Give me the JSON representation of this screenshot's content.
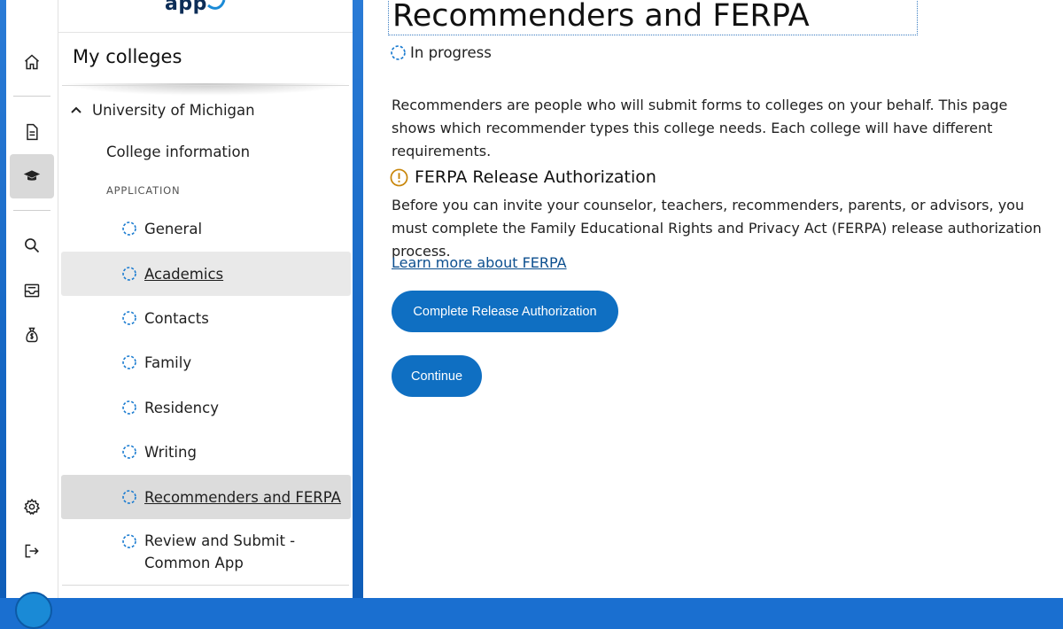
{
  "logo": {
    "text": "app"
  },
  "rail": {
    "items": [
      {
        "name": "home",
        "icon": "home-icon"
      },
      {
        "name": "common-app",
        "icon": "document-icon"
      },
      {
        "name": "my-colleges",
        "icon": "graduation-cap-icon",
        "active": true
      },
      {
        "name": "college-search",
        "icon": "search-icon"
      },
      {
        "name": "messages",
        "icon": "inbox-icon"
      },
      {
        "name": "financial-aid",
        "icon": "money-bag-icon"
      },
      {
        "name": "settings",
        "icon": "gear-icon"
      },
      {
        "name": "sign-out",
        "icon": "sign-out-icon"
      }
    ]
  },
  "sidebar": {
    "title": "My colleges",
    "college": "University of Michigan",
    "college_info": "College information",
    "section_label": "APPLICATION",
    "items": [
      {
        "label": "General",
        "selected": false
      },
      {
        "label": "Academics",
        "selected": "hover"
      },
      {
        "label": "Contacts",
        "selected": false
      },
      {
        "label": "Family",
        "selected": false
      },
      {
        "label": "Residency",
        "selected": false
      },
      {
        "label": "Writing",
        "selected": false
      },
      {
        "label": "Recommenders and FERPA",
        "selected": true
      },
      {
        "label": "Review and Submit -\nCommon App",
        "selected": false
      }
    ]
  },
  "main": {
    "title": "Recommenders and FERPA",
    "status": "In progress",
    "intro": "Recommenders are people who will submit forms to colleges on your behalf. This page shows which recommender types this college needs. Each college will have different requirements.",
    "ferpa_heading": "FERPA Release Authorization",
    "ferpa_body": "Before you can invite your counselor, teachers, recommenders, parents, or advisors, you must complete the Family Educational Rights and Privacy Act (FERPA) release authorization process.",
    "learn_more": "Learn more about FERPA",
    "primary_button": "Complete Release Authorization",
    "continue_button": "Continue"
  },
  "colors": {
    "accent": "#0f6fc2",
    "warning": "#c8860a",
    "progress_dot": "#1a7bd0",
    "frame": "#1567c4"
  }
}
